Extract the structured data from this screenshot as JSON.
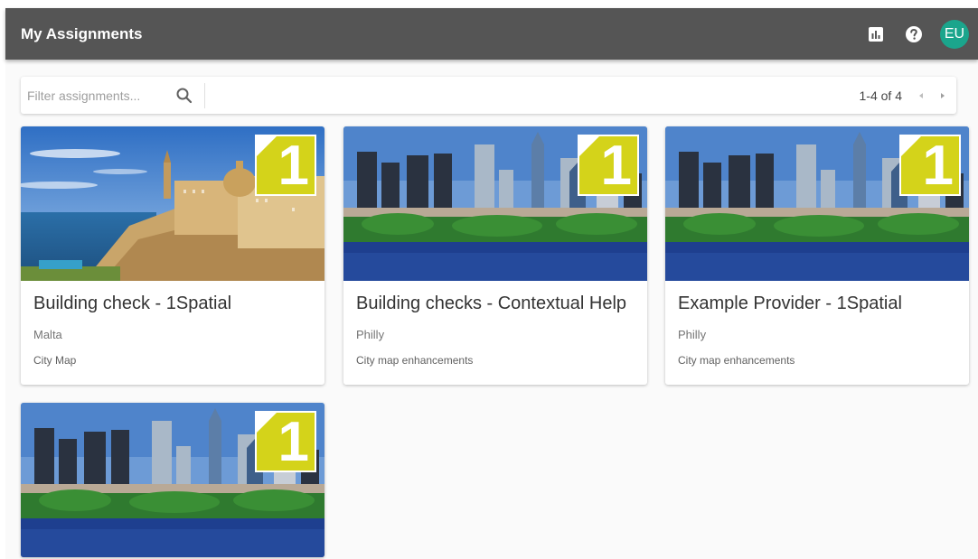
{
  "header": {
    "title": "My Assignments",
    "avatar_initials": "EU",
    "icons": [
      "bar-chart-icon",
      "help-icon"
    ]
  },
  "filter": {
    "placeholder": "Filter assignments...",
    "value": "",
    "range_text": "1-4 of 4"
  },
  "cards": [
    {
      "title": "Building check - 1Spatial",
      "location": "Malta",
      "description": "City Map",
      "badge": "1",
      "image": "malta-city"
    },
    {
      "title": "Building checks - Contextual Help",
      "location": "Philly",
      "description": "City map enhancements",
      "badge": "1",
      "image": "philly-skyline"
    },
    {
      "title": "Example Provider - 1Spatial",
      "location": "Philly",
      "description": "City map enhancements",
      "badge": "1",
      "image": "philly-skyline"
    },
    {
      "title": "",
      "location": "",
      "description": "",
      "badge": "1",
      "image": "philly-skyline"
    }
  ],
  "colors": {
    "appbar": "#555555",
    "avatar": "#1ba58c",
    "badge": "#d4d31a",
    "background": "#fafafa"
  }
}
